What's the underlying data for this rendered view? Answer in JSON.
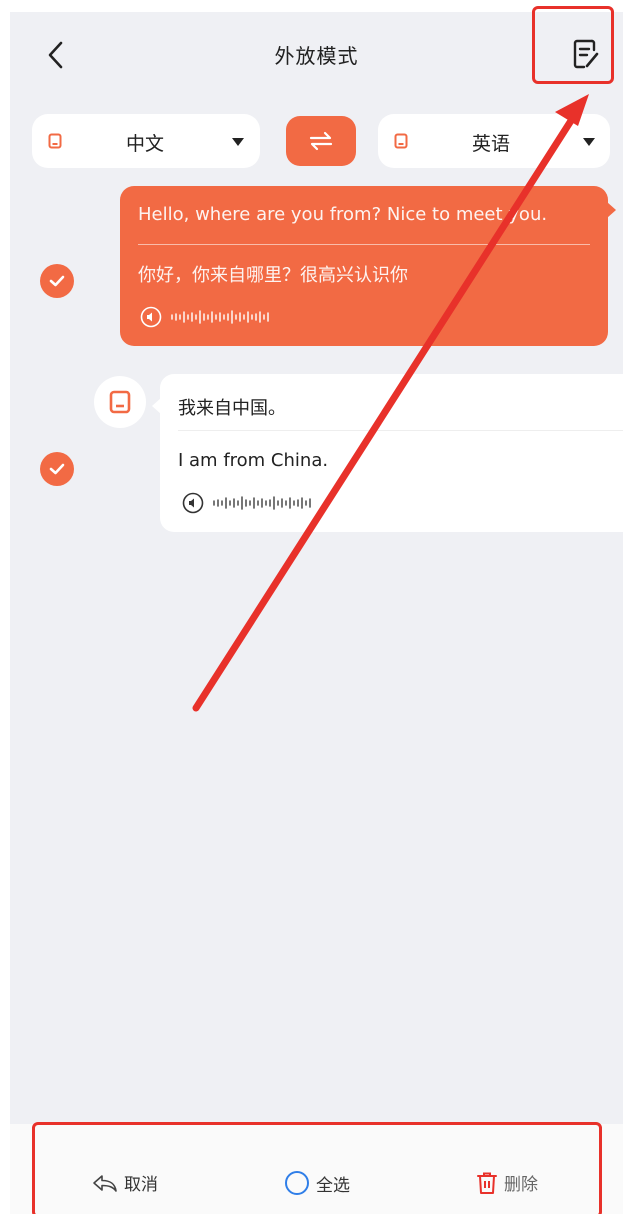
{
  "header": {
    "title": "外放模式",
    "back_icon": "chevron-left-icon",
    "edit_icon": "edit-note-icon"
  },
  "languages": {
    "left": {
      "label": "中文",
      "icon": "device-icon"
    },
    "right": {
      "label": "英语",
      "icon": "device-icon"
    },
    "swap_icon": "swap-arrows-icon"
  },
  "messages": [
    {
      "side": "me",
      "checked": true,
      "source": "Hello, where are you from? Nice to meet you.",
      "translation": "你好，你来自哪里？很高兴认识你"
    },
    {
      "side": "other",
      "checked": true,
      "source": "我来自中国。",
      "translation": "I am from China."
    }
  ],
  "bottom_bar": {
    "cancel_label": "取消",
    "select_all_label": "全选",
    "delete_label": "删除"
  },
  "colors": {
    "accent": "#f26a44",
    "annotation": "#e8312a",
    "background": "#eff0f4"
  }
}
